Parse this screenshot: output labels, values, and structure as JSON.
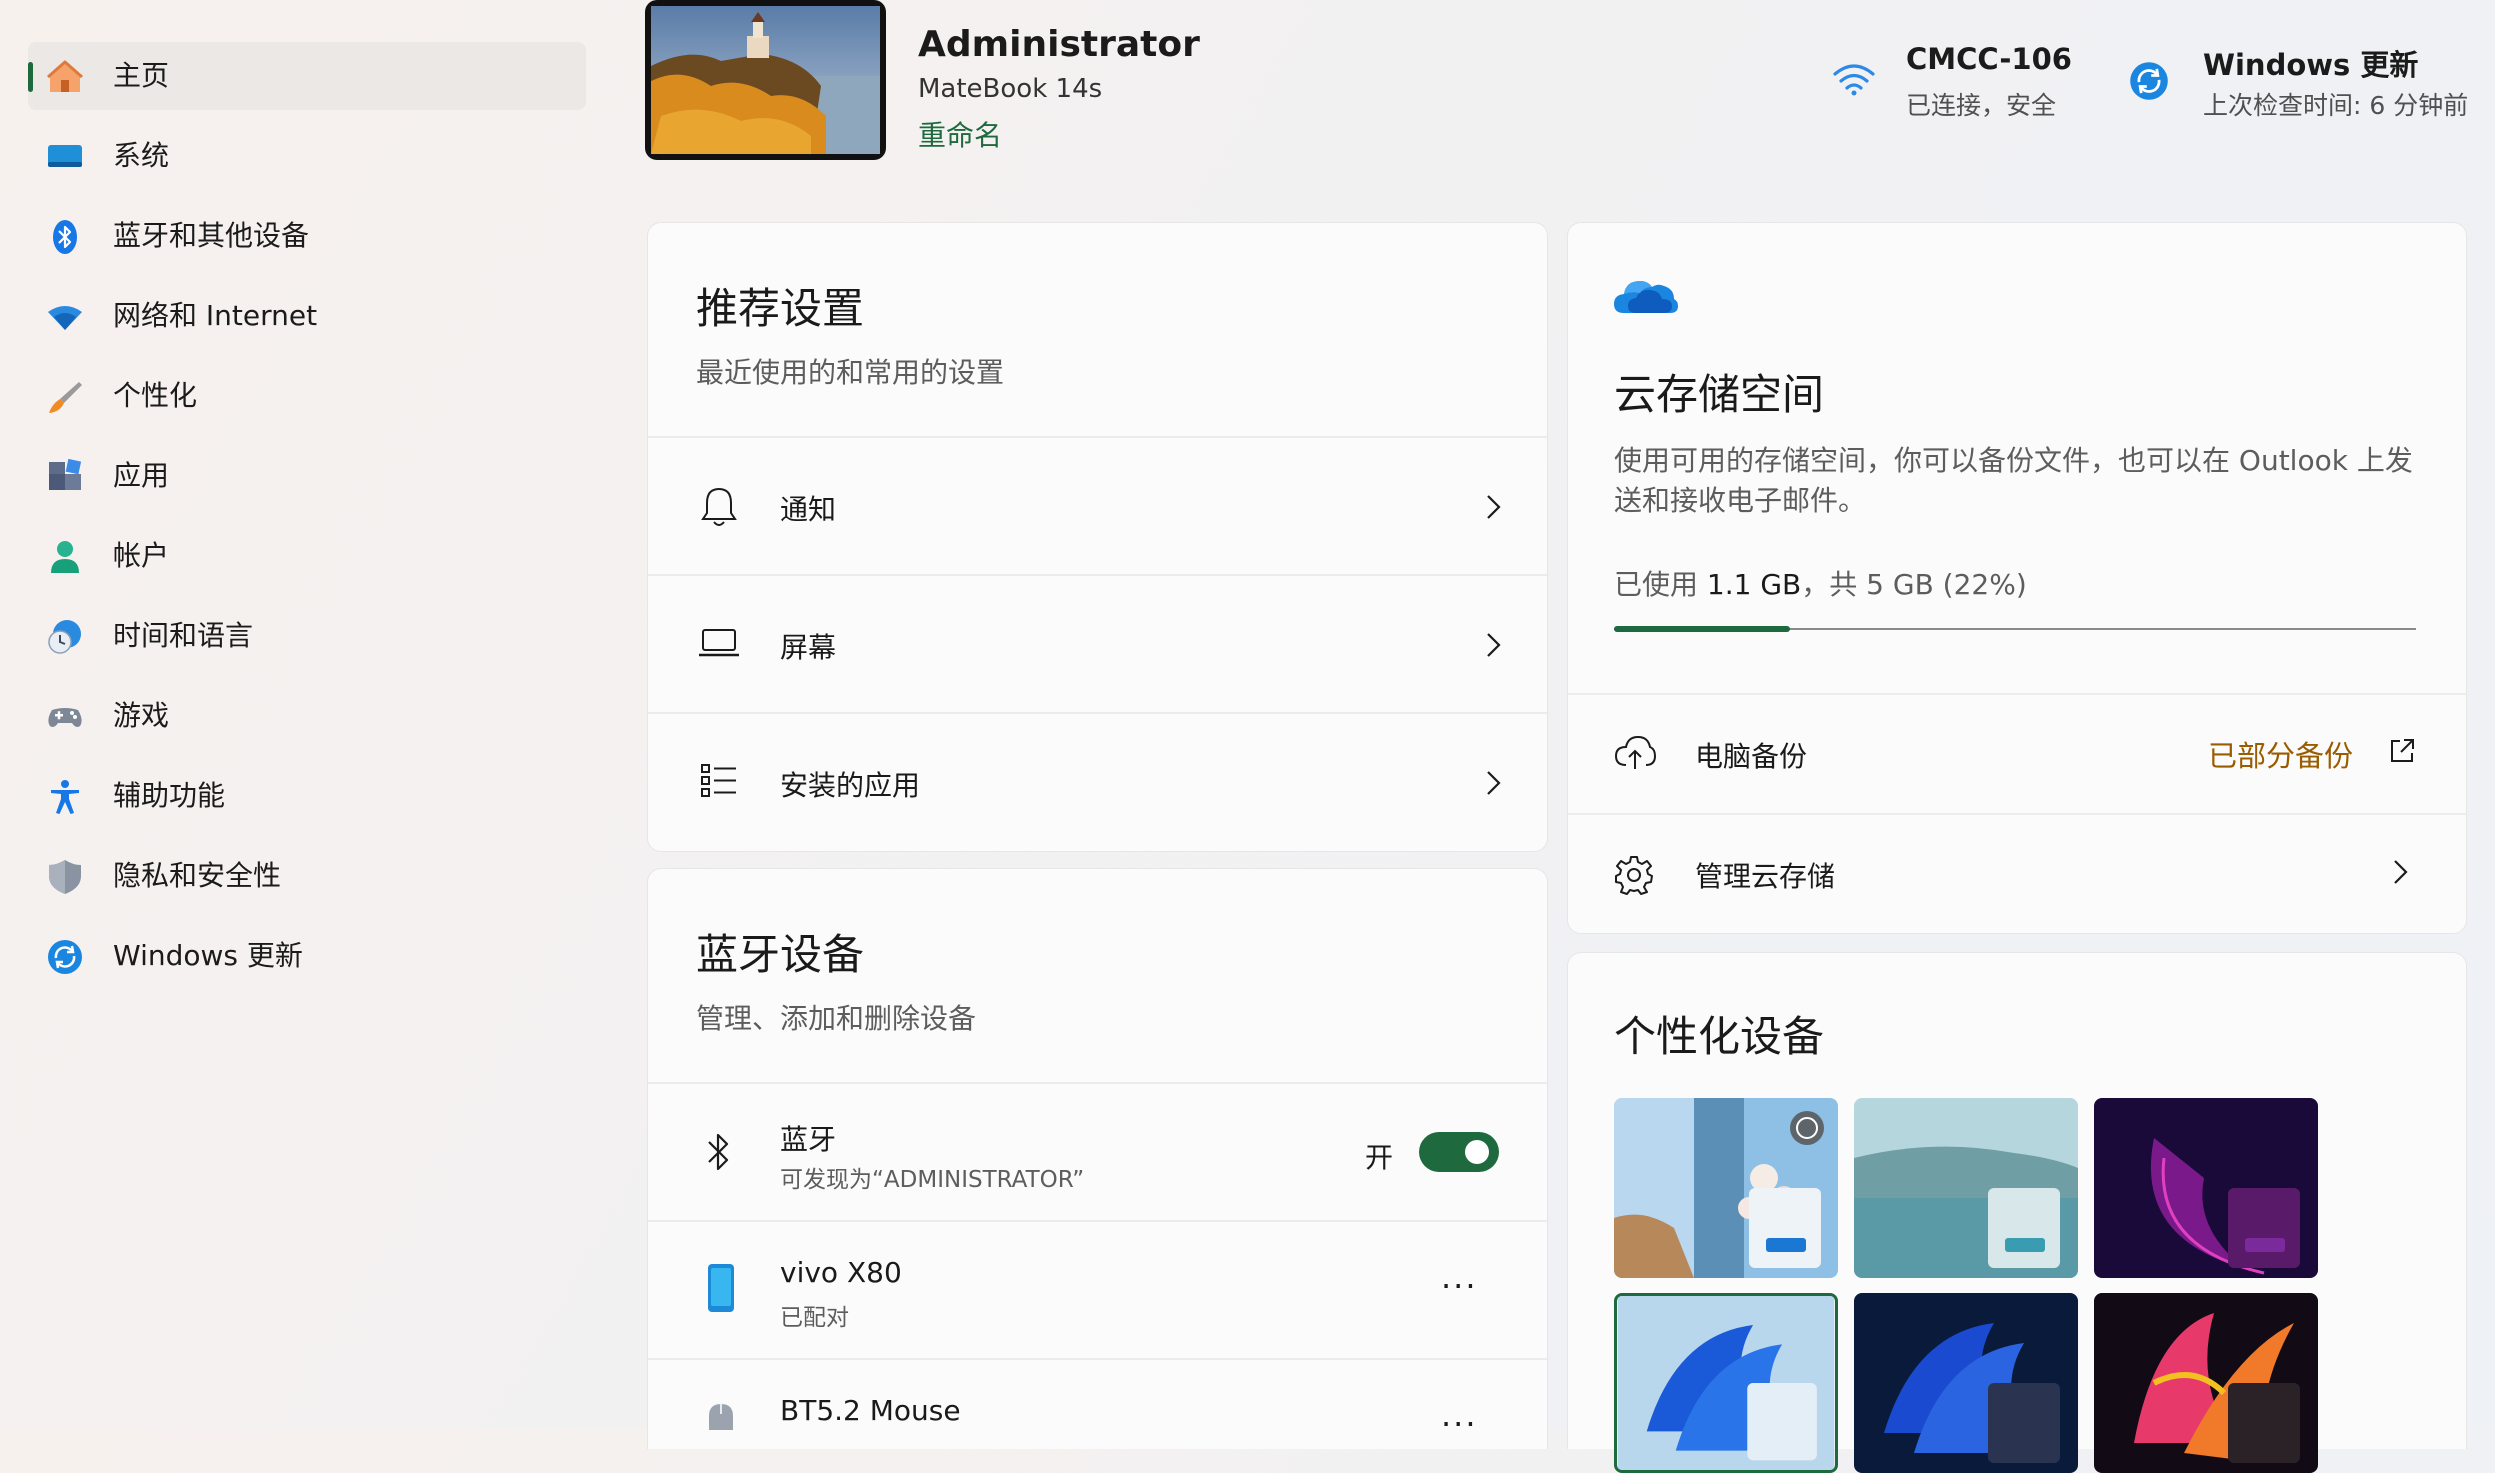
{
  "sidebar": {
    "items": [
      {
        "label": "主页",
        "icon": "home-icon"
      },
      {
        "label": "系统",
        "icon": "system-display-icon"
      },
      {
        "label": "蓝牙和其他设备",
        "icon": "bluetooth-icon"
      },
      {
        "label": "网络和 Internet",
        "icon": "wifi-icon"
      },
      {
        "label": "个性化",
        "icon": "paintbrush-icon"
      },
      {
        "label": "应用",
        "icon": "apps-icon"
      },
      {
        "label": "帐户",
        "icon": "account-icon"
      },
      {
        "label": "时间和语言",
        "icon": "time-language-icon"
      },
      {
        "label": "游戏",
        "icon": "gamepad-icon"
      },
      {
        "label": "辅助功能",
        "icon": "accessibility-icon"
      },
      {
        "label": "隐私和安全性",
        "icon": "shield-icon"
      },
      {
        "label": "Windows 更新",
        "icon": "windows-update-icon"
      }
    ]
  },
  "header": {
    "user_name": "Administrator",
    "device": "MateBook 14s",
    "rename": "重命名",
    "network": {
      "title": "CMCC-106",
      "status": "已连接，安全"
    },
    "update": {
      "title": "Windows 更新",
      "status": "上次检查时间: 6 分钟前"
    }
  },
  "recommended": {
    "title": "推荐设置",
    "subtitle": "最近使用的和常用的设置",
    "items": [
      {
        "label": "通知",
        "icon": "bell-icon"
      },
      {
        "label": "屏幕",
        "icon": "laptop-icon"
      },
      {
        "label": "安装的应用",
        "icon": "list-icon"
      }
    ]
  },
  "bluetooth": {
    "title": "蓝牙设备",
    "subtitle": "管理、添加和删除设备",
    "toggle": {
      "label": "蓝牙",
      "sub": "可发现为“ADMINISTRATOR”",
      "state": "开",
      "on": true
    },
    "devices": [
      {
        "name": "vivo X80",
        "status": "已配对",
        "menu": "..."
      },
      {
        "name": "BT5.2 Mouse",
        "status": "",
        "menu": "..."
      }
    ]
  },
  "cloud": {
    "title": "云存储空间",
    "description": "使用可用的存储空间，你可以备份文件，也可以在 Outlook 上发送和接收电子邮件。",
    "usage_prefix": "已使用 ",
    "usage_used": "1.1 GB",
    "usage_suffix": "，共 5 GB (22%)",
    "usage_fraction": 0.22,
    "backup": {
      "label": "电脑备份",
      "status": "已部分备份"
    },
    "manage": {
      "label": "管理云存储"
    }
  },
  "personalize": {
    "title": "个性化设备",
    "themes": [
      "spring-blossom",
      "lake-glow",
      "purple-bloom",
      "windows-light-bloom",
      "windows-dark-bloom",
      "flow-colorful"
    ]
  },
  "colors": {
    "accent": "#1e6a3e",
    "progress_fill": "#1e6a3e",
    "backup_status": "#9a5c00",
    "wifi": "#2b8ae6"
  }
}
